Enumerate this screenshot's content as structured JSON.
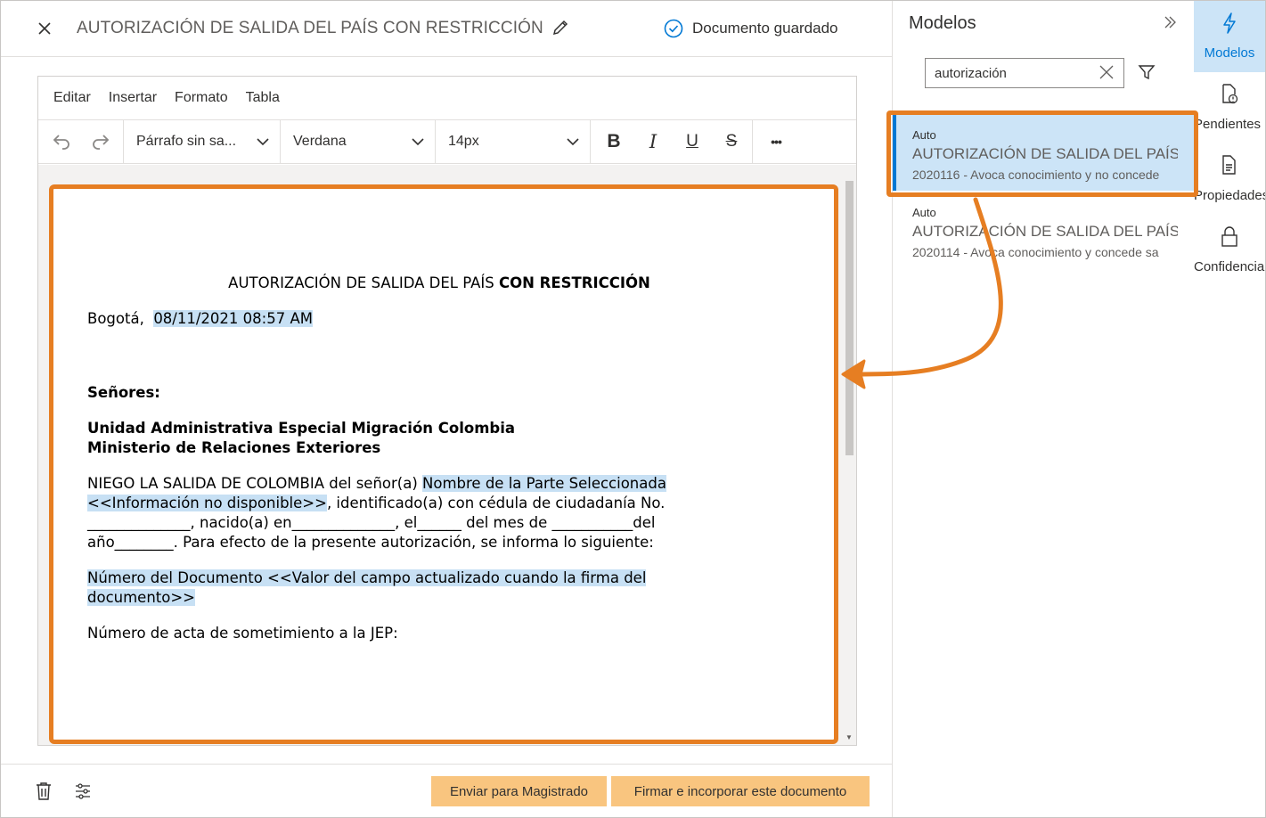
{
  "header": {
    "title": "AUTORIZACIÓN DE SALIDA DEL PAÍS CON RESTRICCIÓN",
    "saved_status": "Documento guardado"
  },
  "editor": {
    "menu": [
      "Editar",
      "Insertar",
      "Formato",
      "Tabla"
    ],
    "toolbar": {
      "paragraph_style": "Párrafo sin sa...",
      "font_family": "Verdana",
      "font_size": "14px",
      "bold_label": "B",
      "italic_label": "I",
      "underline_label": "U",
      "strike_label": "S",
      "more_label": "•••"
    },
    "document": {
      "title_normal": "AUTORIZACIÓN DE SALIDA DEL PAÍS ",
      "title_bold": "CON RESTRICCIÓN",
      "city": "Bogotá,",
      "date": "08/11/2021 08:57 AM",
      "salutation": "Señores:",
      "recipient_1": "Unidad Administrativa Especial Migración Colombia",
      "recipient_2": "Ministerio de Relaciones Exteriores",
      "body_1": "NIEGO LA SALIDA DE COLOMBIA del señor(a) ",
      "body_party": "Nombre de la Parte Seleccionada",
      "body_info": "<<Información no disponible>>",
      "body_2": ", identificado(a) con cédula de ciudadanía No.",
      "body_3": "______________, nacido(a) en______________, el______ del mes de ___________del",
      "body_4": "año________. Para efecto de la presente autorización, se informa lo siguiente:",
      "doc_number": "Número del Documento <<Valor del campo actualizado cuando la firma del",
      "doc_number_2": "documento>>",
      "act_number": "Número de acta de sometimiento a la JEP:"
    }
  },
  "footer": {
    "send_button": "Enviar para Magistrado",
    "sign_button": "Firmar e incorporar este documento"
  },
  "models_panel": {
    "title": "Modelos",
    "search": {
      "value": "autorización"
    },
    "items": [
      {
        "type": "Auto",
        "name": "AUTORIZACIÓN DE SALIDA DEL PAÍS CON RESTRICCIÓN",
        "description": "2020116 - Avoca conocimiento y no concede"
      },
      {
        "type": "Auto",
        "name": "AUTORIZACIÓN DE SALIDA DEL PAÍS SIN RESTRICCIÓN",
        "description": "2020114 - Avoca conocimiento y concede sa"
      }
    ]
  },
  "rail": {
    "items": [
      {
        "label": "Modelos",
        "icon": "lightning-icon"
      },
      {
        "label": "Pendientes",
        "icon": "document-clock-icon"
      },
      {
        "label": "Propiedades",
        "icon": "document-list-icon"
      },
      {
        "label": "Confidencialidad",
        "icon": "lock-icon"
      }
    ]
  },
  "colors": {
    "accent": "#0078d4",
    "highlight_orange": "#e67e22",
    "selection_blue": "#cce4f7",
    "text_highlight": "#c7e0f4",
    "button_orange": "#f9c57f"
  }
}
